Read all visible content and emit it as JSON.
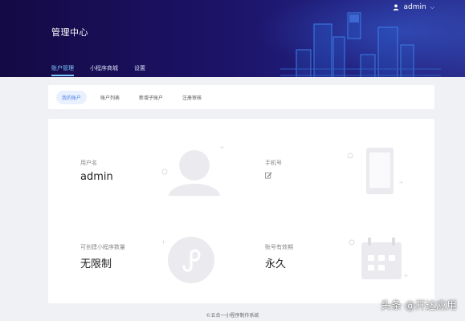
{
  "header": {
    "user_name": "admin",
    "user_icon": "user-icon",
    "dropdown_icon": "chevron-down-icon",
    "title": "管理中心",
    "tabs": [
      {
        "label": "账户管理",
        "active": true
      },
      {
        "label": "小程序商城",
        "active": false
      },
      {
        "label": "设置",
        "active": false
      }
    ]
  },
  "subnav": {
    "items": [
      {
        "label": "我的账户",
        "active": true
      },
      {
        "label": "账户列表",
        "active": false
      },
      {
        "label": "新增子账户",
        "active": false
      },
      {
        "label": "注册审核",
        "active": false
      }
    ]
  },
  "account": {
    "username_label": "用户名",
    "username_value": "admin",
    "phone_label": "手机号",
    "phone_edit_icon": "edit-icon",
    "quota_label": "可创建小程序数量",
    "quota_value": "无限制",
    "validity_label": "账号有效期",
    "validity_value": "永久"
  },
  "footer": {
    "text": "©五合一小程序制作系统"
  },
  "watermark": {
    "text": "头条 @开达应用"
  },
  "colors": {
    "header_bg": "#1c1266",
    "active_tab": "#7cc8ff",
    "active_pill_bg": "#e9f1ff",
    "illustration": "#eeeef2"
  }
}
